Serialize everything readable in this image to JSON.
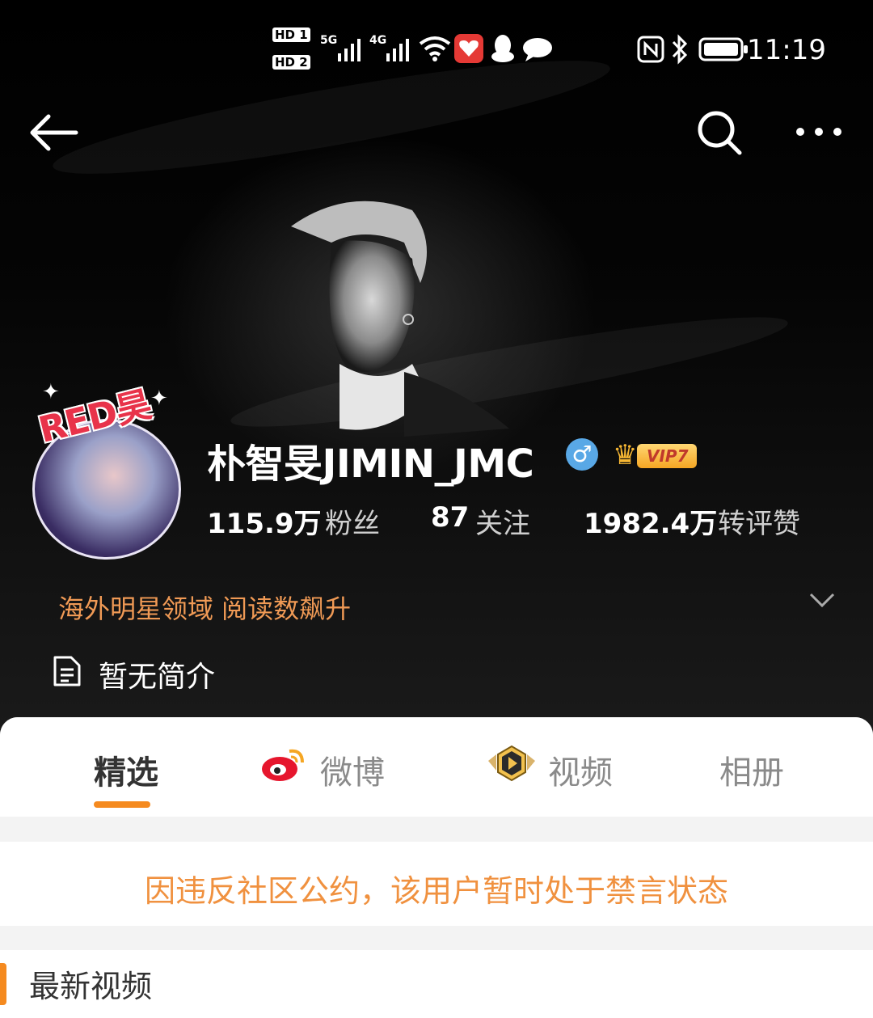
{
  "status_bar": {
    "sim1": "HD 1",
    "sim2": "HD 2",
    "net1": "5G",
    "net2": "4G",
    "time": "11:19",
    "icons": [
      "wifi-icon",
      "app-notification-icon",
      "qq-icon",
      "message-icon",
      "nfc-icon",
      "bluetooth-icon",
      "battery-icon"
    ]
  },
  "nav": {
    "back_icon": "arrow-left-icon",
    "search_icon": "search-icon",
    "more_icon": "more-dots-icon"
  },
  "profile": {
    "avatar_badge": "RED昊",
    "name": "朴智旻JIMIN_JMC",
    "gender_symbol": "♂",
    "vip_label": "VIP7",
    "stats": [
      {
        "value": "115.9万",
        "label": "粉丝"
      },
      {
        "value": "87",
        "label": "关注"
      },
      {
        "value": "1982.4万",
        "label": "转评赞"
      }
    ],
    "tagline": "海外明星领域 阅读数飙升",
    "bio": "暂无简介"
  },
  "tabs": [
    {
      "label": "精选",
      "active": true
    },
    {
      "label": "微博",
      "active": false
    },
    {
      "label": "视频",
      "active": false
    },
    {
      "label": "相册",
      "active": false
    }
  ],
  "notice": "因违反社区公约，该用户暂时处于禁言状态",
  "section_title": "最新视频",
  "colors": {
    "accent": "#f58a1f",
    "notice": "#f0913f",
    "tagline": "#f09a55",
    "verified": "#59a8e6"
  }
}
